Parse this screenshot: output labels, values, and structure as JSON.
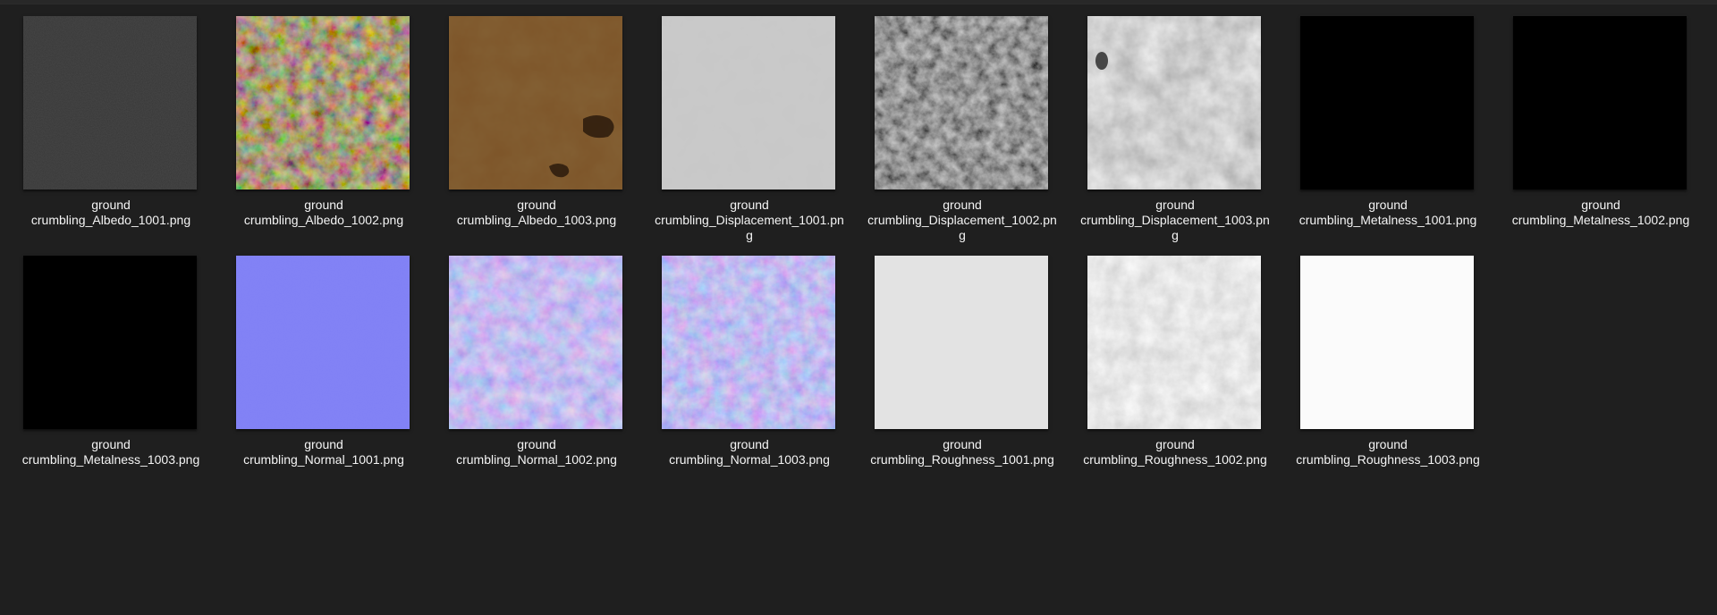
{
  "files": [
    {
      "line1": "ground",
      "line2": "crumbling_Albedo_1001.png",
      "line3": "",
      "thumbnail": "albedo-dark-gray",
      "color": "#373737"
    },
    {
      "line1": "ground",
      "line2": "crumbling_Albedo_1002.png",
      "line3": "",
      "thumbnail": "albedo-rocky-brown",
      "color": "#3d3529"
    },
    {
      "line1": "ground",
      "line2": "crumbling_Albedo_1003.png",
      "line3": "",
      "thumbnail": "albedo-orange-dirt",
      "color": "#7a5227"
    },
    {
      "line1": "ground",
      "line2": "crumbling_Displacement_1001.pn",
      "line3": "g",
      "thumbnail": "displacement-light-gray",
      "color": "#c6c6c6"
    },
    {
      "line1": "ground",
      "line2": "crumbling_Displacement_1002.pn",
      "line3": "g",
      "thumbnail": "displacement-dark-rocks",
      "color": "#3a3a3a"
    },
    {
      "line1": "ground",
      "line2": "crumbling_Displacement_1003.pn",
      "line3": "g",
      "thumbnail": "displacement-mid-gray",
      "color": "#a8a8a8"
    },
    {
      "line1": "ground",
      "line2": "crumbling_Metalness_1001.png",
      "line3": "",
      "thumbnail": "metalness-black",
      "color": "#000000"
    },
    {
      "line1": "ground",
      "line2": "crumbling_Metalness_1002.png",
      "line3": "",
      "thumbnail": "metalness-black",
      "color": "#000000"
    },
    {
      "line1": "ground",
      "line2": "crumbling_Metalness_1003.png",
      "line3": "",
      "thumbnail": "metalness-black",
      "color": "#000000"
    },
    {
      "line1": "ground",
      "line2": "crumbling_Normal_1001.png",
      "line3": "",
      "thumbnail": "normal-flat-blue",
      "color": "#7f7ff5"
    },
    {
      "line1": "ground",
      "line2": "crumbling_Normal_1002.png",
      "line3": "",
      "thumbnail": "normal-bumpy-blue",
      "color": "#8a82ee"
    },
    {
      "line1": "ground",
      "line2": "crumbling_Normal_1003.png",
      "line3": "",
      "thumbnail": "normal-bumpy-blue",
      "color": "#857ff0"
    },
    {
      "line1": "ground",
      "line2": "crumbling_Roughness_1001.png",
      "line3": "",
      "thumbnail": "roughness-light-gray",
      "color": "#e3e3e3"
    },
    {
      "line1": "ground",
      "line2": "crumbling_Roughness_1002.png",
      "line3": "",
      "thumbnail": "roughness-mottled-gray",
      "color": "#c9c9c9"
    },
    {
      "line1": "ground",
      "line2": "crumbling_Roughness_1003.png",
      "line3": "",
      "thumbnail": "roughness-white",
      "color": "#fbfbfb"
    }
  ]
}
